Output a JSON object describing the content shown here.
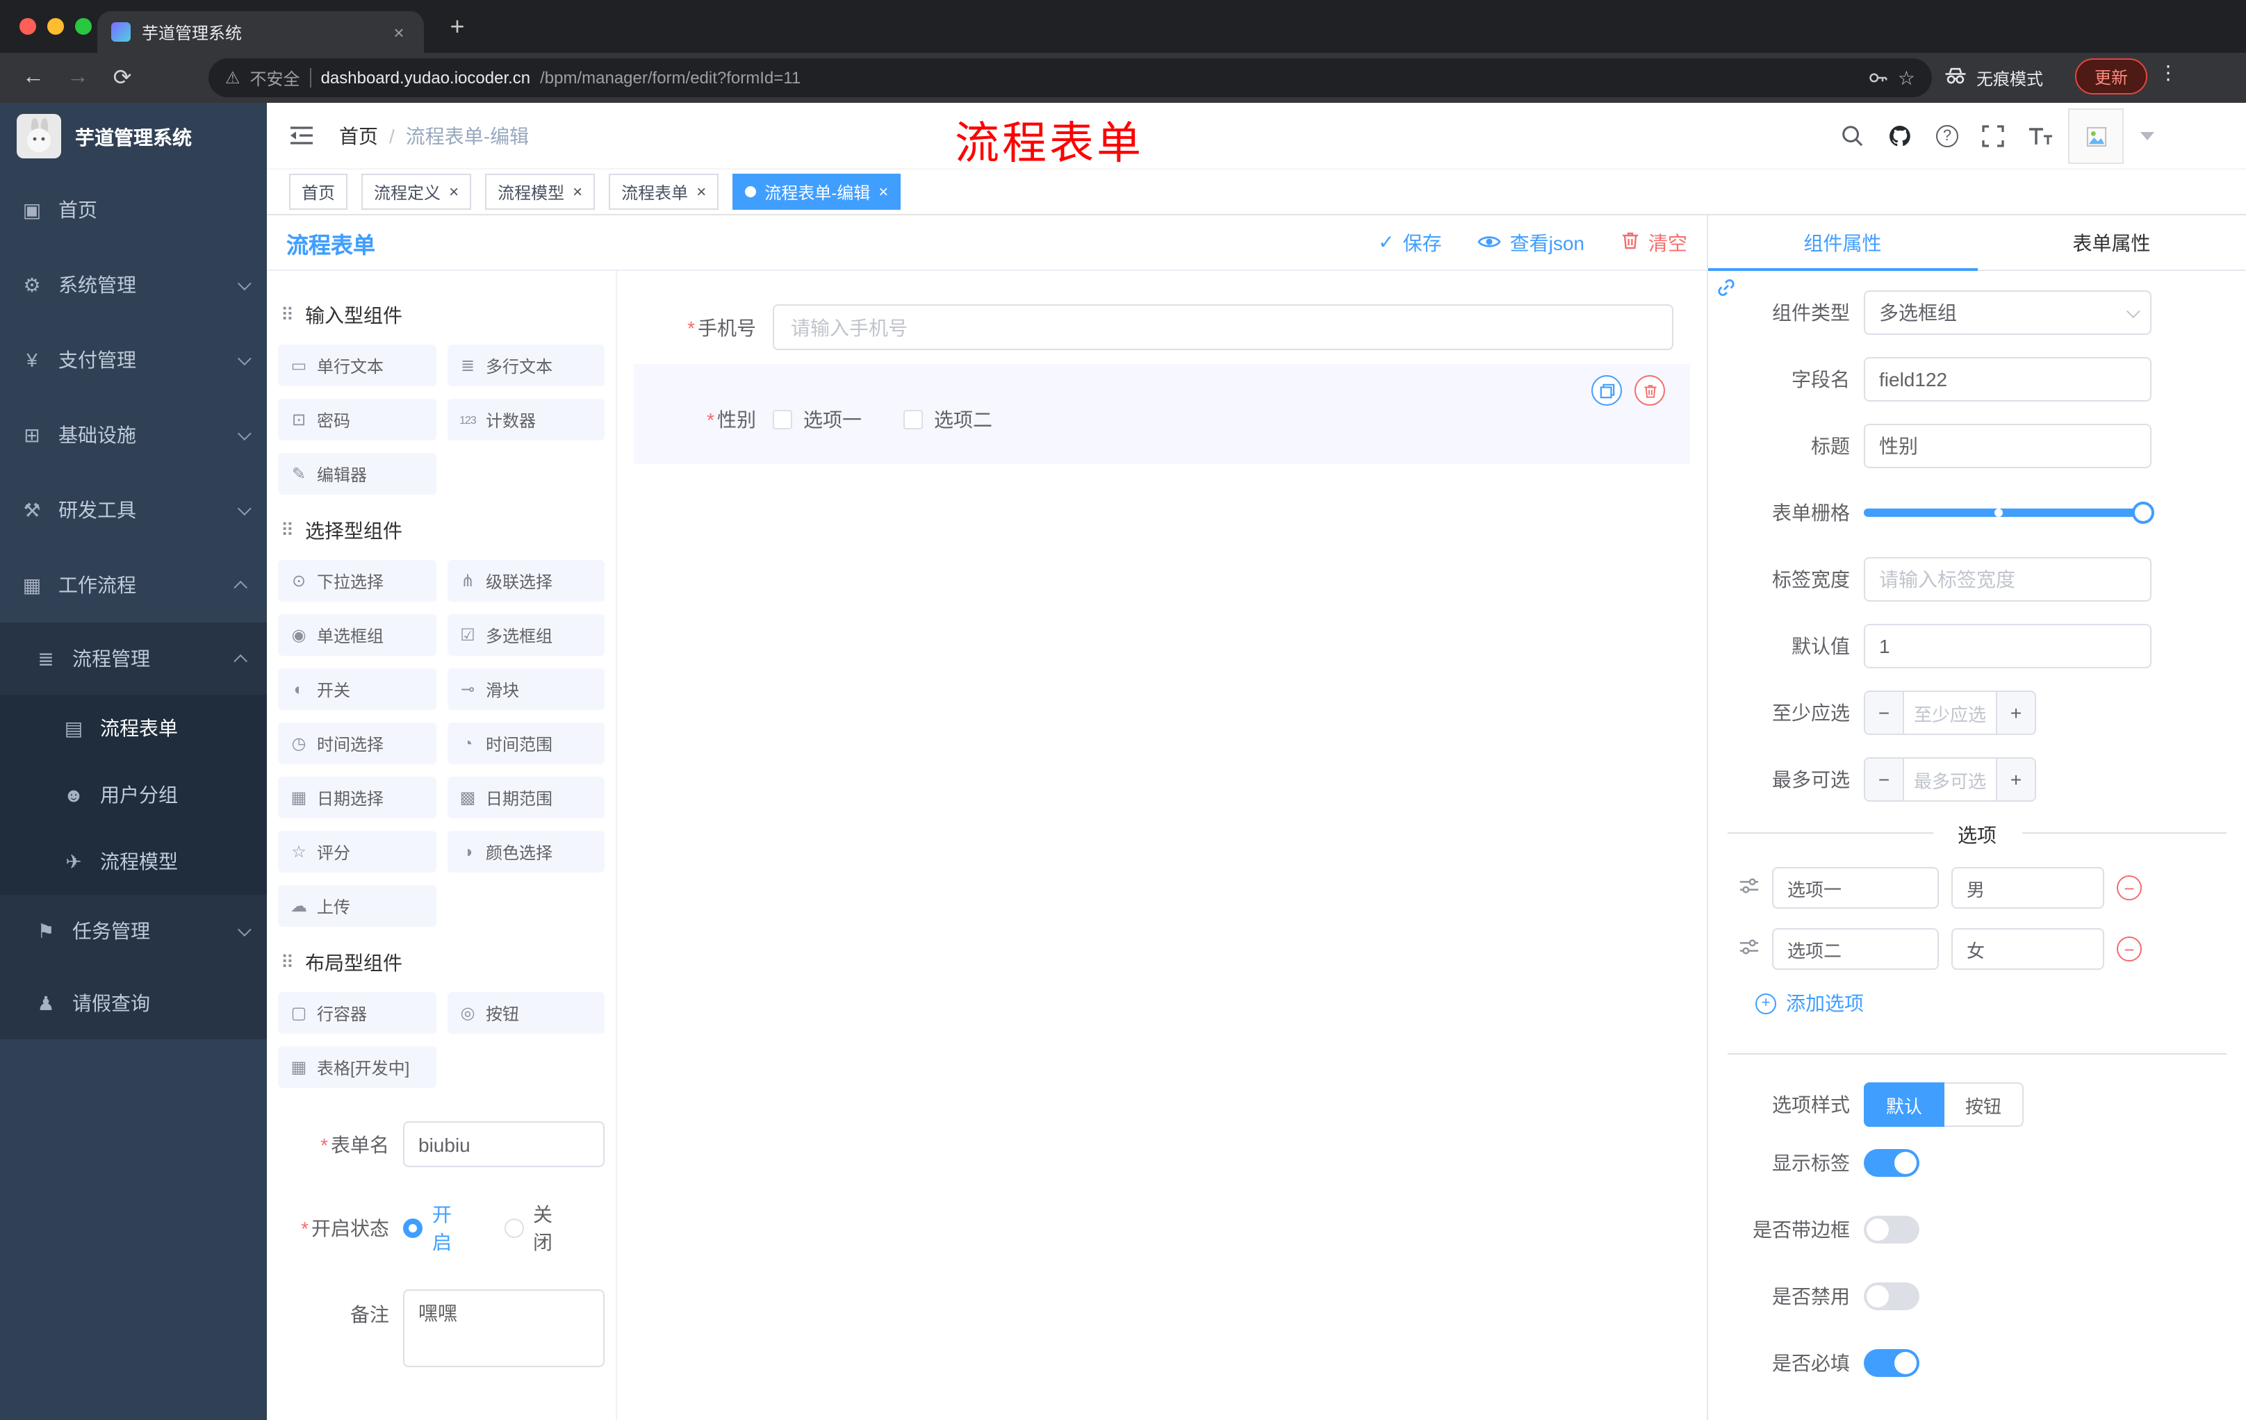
{
  "ui": {
    "required_mark": "*",
    "close_glyph": "×",
    "check_glyph": "✓",
    "kebab_glyph": "⋮",
    "question_glyph": "?",
    "minus_glyph": "−",
    "plus_glyph": "+"
  },
  "colors": {
    "primary": "#409eff",
    "danger": "#f56c6c",
    "annotation": "#ff0000",
    "sidebar_bg": "#304156",
    "active_tag": "#409eff"
  },
  "browser": {
    "tab_title": "芋道管理系统",
    "new_tab_glyph": "+",
    "back_glyph": "←",
    "forward_glyph": "→",
    "reload_glyph": "⟳",
    "warning_glyph": "⚠",
    "star_glyph": "☆",
    "address": {
      "security_label": "不安全",
      "host": "dashboard.yudao.iocoder.cn",
      "path": "/bpm/manager/form/edit?formId=11"
    },
    "incognito_label": "无痕模式",
    "update_label": "更新"
  },
  "sidebar": {
    "logo_title": "芋道管理系统",
    "items": [
      {
        "icon": "▣",
        "label": "首页"
      },
      {
        "icon": "⚙",
        "label": "系统管理"
      },
      {
        "icon": "¥",
        "label": "支付管理"
      },
      {
        "icon": "⊞",
        "label": "基础设施"
      },
      {
        "icon": "⚒",
        "label": "研发工具"
      },
      {
        "icon": "▦",
        "label": "工作流程"
      },
      {
        "icon": "≣",
        "label": "流程管理"
      },
      {
        "icon": "▤",
        "label": "流程表单"
      },
      {
        "icon": "☻",
        "label": "用户分组"
      },
      {
        "icon": "✈",
        "label": "流程模型"
      },
      {
        "icon": "⚑",
        "label": "任务管理"
      },
      {
        "icon": "♟",
        "label": "请假查询"
      }
    ]
  },
  "header": {
    "breadcrumb": {
      "home": "首页",
      "separator": "/",
      "current": "流程表单-编辑"
    },
    "annotation": "流程表单"
  },
  "tags": [
    {
      "label": "首页"
    },
    {
      "label": "流程定义"
    },
    {
      "label": "流程模型"
    },
    {
      "label": "流程表单"
    },
    {
      "label": "流程表单-编辑"
    }
  ],
  "designer": {
    "title": "流程表单",
    "actions": {
      "save": "保存",
      "view_json": "查看json",
      "clear": "清空"
    },
    "component_groups": [
      {
        "icon": "⠿",
        "title": "输入型组件",
        "items": [
          {
            "icon": "▭",
            "label": "单行文本"
          },
          {
            "icon": "≣",
            "label": "多行文本"
          },
          {
            "icon": "⊡",
            "label": "密码"
          },
          {
            "icon": "123",
            "label": "计数器"
          },
          {
            "icon": "✎",
            "label": "编辑器"
          }
        ]
      },
      {
        "icon": "⠿",
        "title": "选择型组件",
        "items": [
          {
            "icon": "⊙",
            "label": "下拉选择"
          },
          {
            "icon": "⋔",
            "label": "级联选择"
          },
          {
            "icon": "◉",
            "label": "单选框组"
          },
          {
            "icon": "☑",
            "label": "多选框组"
          },
          {
            "icon": "◐",
            "label": "开关"
          },
          {
            "icon": "⊸",
            "label": "滑块"
          },
          {
            "icon": "◷",
            "label": "时间选择"
          },
          {
            "icon": "◔",
            "label": "时间范围"
          },
          {
            "icon": "▦",
            "label": "日期选择"
          },
          {
            "icon": "▩",
            "label": "日期范围"
          },
          {
            "icon": "☆",
            "label": "评分"
          },
          {
            "icon": "◑",
            "label": "颜色选择"
          },
          {
            "icon": "☁",
            "label": "上传"
          }
        ]
      },
      {
        "icon": "⠿",
        "title": "布局型组件",
        "items": [
          {
            "icon": "▢",
            "label": "行容器"
          },
          {
            "icon": "◎",
            "label": "按钮"
          },
          {
            "icon": "▦",
            "label": "表格[开发中]"
          }
        ]
      }
    ],
    "meta_form": {
      "form_name_label": "表单名",
      "form_name_value": "biubiu",
      "status_label": "开启状态",
      "status_options": [
        "开启",
        "关闭"
      ],
      "remark_label": "备注",
      "remark_value": "嘿嘿"
    },
    "canvas": {
      "phone_label": "手机号",
      "phone_placeholder": "请输入手机号",
      "gender_label": "性别",
      "gender_options": [
        "选项一",
        "选项二"
      ]
    }
  },
  "properties": {
    "tabs": [
      "组件属性",
      "表单属性"
    ],
    "fields": {
      "component_type_label": "组件类型",
      "component_type_value": "多选框组",
      "field_name_label": "字段名",
      "field_name_value": "field122",
      "title_label": "标题",
      "title_value": "性别",
      "grid_label": "表单栅格",
      "label_width_label": "标签宽度",
      "label_width_placeholder": "请输入标签宽度",
      "default_label": "默认值",
      "default_value": "1",
      "min_label": "至少应选",
      "min_placeholder": "至少应选",
      "max_label": "最多可选",
      "max_placeholder": "最多可选"
    },
    "options_divider": "选项",
    "options": [
      {
        "label": "选项一",
        "value": "男"
      },
      {
        "label": "选项二",
        "value": "女"
      }
    ],
    "add_option_label": "添加选项",
    "style_label": "选项样式",
    "style_options": [
      "默认",
      "按钮"
    ],
    "switches": [
      {
        "label": "显示标签",
        "on": true
      },
      {
        "label": "是否带边框",
        "on": false
      },
      {
        "label": "是否禁用",
        "on": false
      },
      {
        "label": "是否必填",
        "on": true
      }
    ]
  }
}
